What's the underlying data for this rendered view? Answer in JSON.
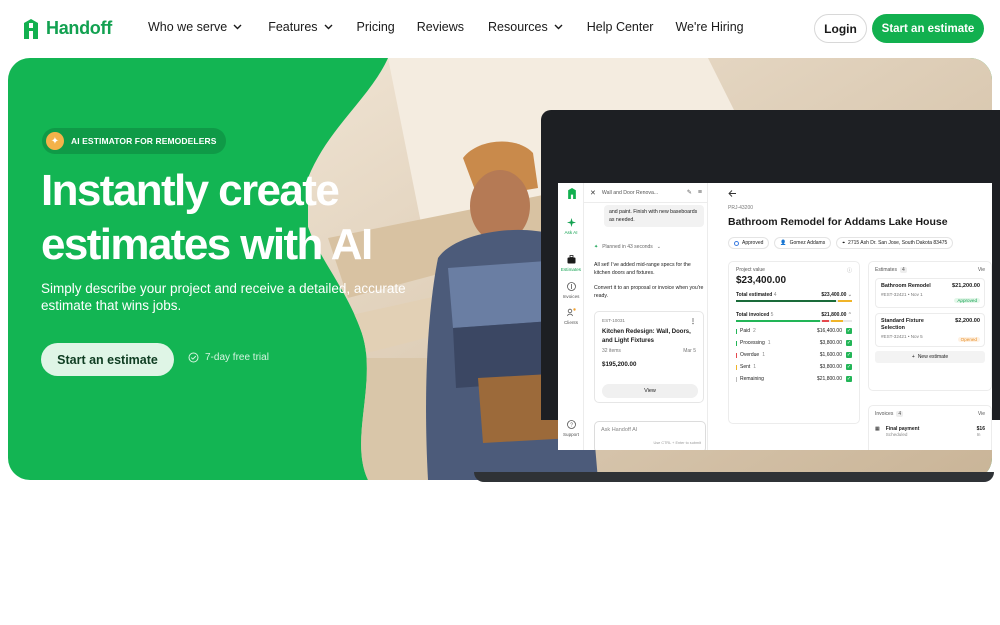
{
  "brand": {
    "name": "Handoff",
    "color": "#12b04f"
  },
  "nav": {
    "items": [
      {
        "label": "Who we serve",
        "dropdown": true
      },
      {
        "label": "Features",
        "dropdown": true
      },
      {
        "label": "Pricing",
        "dropdown": false
      },
      {
        "label": "Reviews",
        "dropdown": false
      },
      {
        "label": "Resources",
        "dropdown": true
      },
      {
        "label": "Help Center",
        "dropdown": false
      },
      {
        "label": "We're Hiring",
        "dropdown": false
      }
    ],
    "login": "Login",
    "cta": "Start an estimate"
  },
  "hero": {
    "badge": "AI ESTIMATOR FOR REMODELERS",
    "headline_line1": "Instantly create",
    "headline_line2": "estimates with AI",
    "subheadline": "Simply describe your project and receive a detailed, accurate estimate that wins jobs.",
    "cta": "Start an estimate",
    "trial": "7-day free trial"
  },
  "app": {
    "rail": [
      {
        "label": "Ask AI",
        "icon": "sparkle-icon",
        "active": true
      },
      {
        "label": "Estimates",
        "icon": "briefcase-icon",
        "active": true
      },
      {
        "label": "Invoices",
        "icon": "dollar-icon",
        "active": false
      },
      {
        "label": "Clients",
        "icon": "users-icon",
        "active": false
      },
      {
        "label": "Support",
        "icon": "help-icon",
        "active": false
      }
    ],
    "chat": {
      "title": "Wall and Door Renova...",
      "bubble": "and paint. Finish with new baseboards as needed.",
      "planned": "Planned in 43 seconds",
      "msg1": "All set! I've added mid-range specs for the kitchen doors and fixtures.",
      "msg2": "Convert it to an proposal or invoice when you're ready.",
      "card": {
        "id": "EST-10031",
        "title": "Kitchen Redesign: Wall, Doors, and Light Fixtures",
        "items": "32 items",
        "date": "Mar 5",
        "amount": "$195,200.00",
        "view": "View"
      },
      "ask_placeholder": "Ask Handoff AI",
      "ask_hint": "Use CTRL + Enter to submit"
    },
    "project": {
      "id": "PRJ-43200",
      "title": "Bathroom Remodel for Addams Lake House",
      "status": "Approved",
      "client": "Gomez Addams",
      "address": "2715 Ash Dr. San Jose, South Dakota 83475",
      "value_label": "Project value",
      "value": "$23,400.00",
      "total_estimated_label": "Total estimated",
      "total_estimated_count": "4",
      "total_estimated": "$23,400.00",
      "total_invoiced_label": "Total invoiced",
      "total_invoiced_count": "5",
      "total_invoiced": "$21,800.00",
      "breakdown": [
        {
          "label": "Paid",
          "count": "2",
          "amount": "$16,400.00",
          "color": "#22b557"
        },
        {
          "label": "Processing",
          "count": "1",
          "amount": "$3,800.00",
          "color": "#22b557"
        },
        {
          "label": "Overdue",
          "count": "1",
          "amount": "$1,600.00",
          "color": "#e5484d"
        },
        {
          "label": "Sent",
          "count": "1",
          "amount": "$3,800.00",
          "color": "#f0b429"
        },
        {
          "label": "Remaining",
          "count": "",
          "amount": "$21,800.00",
          "color": "#bbbbbb"
        }
      ]
    },
    "estimates": {
      "label": "Estimates",
      "count": "4",
      "view": "Vie",
      "items": [
        {
          "title": "Bathroom Remodel",
          "amount": "$21,200.00",
          "meta": "#EST-32421 • Nov 1",
          "status": "Approved"
        },
        {
          "title": "Standard Fixture Selection",
          "amount": "$2,200.00",
          "meta": "#EST-32421 • Nov 5",
          "status": "Opened"
        }
      ],
      "new": "New estimate"
    },
    "invoices": {
      "label": "Invoices",
      "count": "4",
      "view": "Vie",
      "item": {
        "title": "Final payment",
        "sub": "Scheduled",
        "amount": "$16",
        "due": "In"
      }
    }
  }
}
